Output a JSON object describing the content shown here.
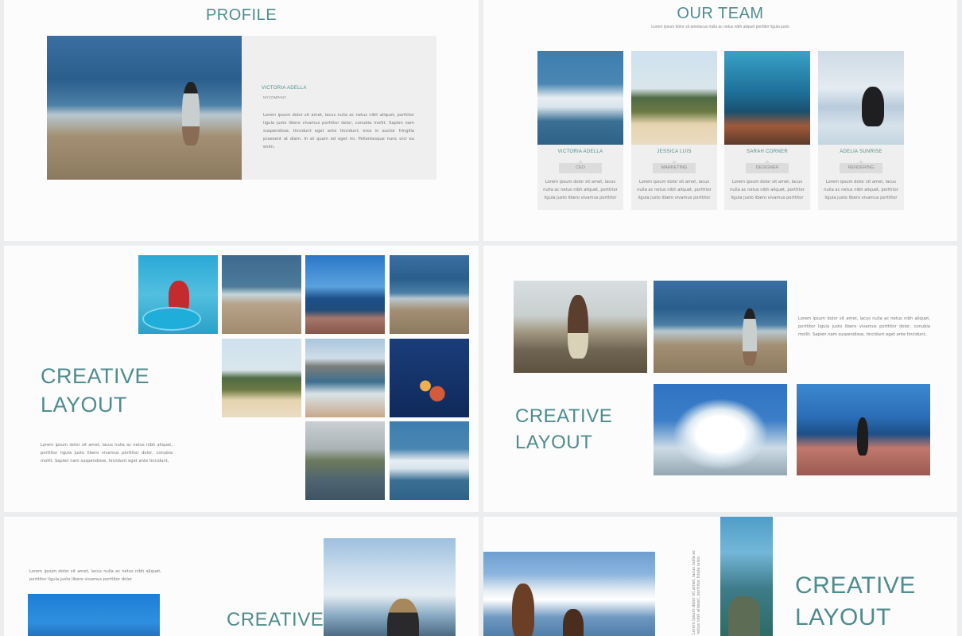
{
  "slides": {
    "profile": {
      "title": "PROFILE",
      "name": "VICTORIA ADELLA",
      "company": "MYCOMPANY",
      "text": "Lorem ipsum dolor sit amet, lacus nulla ac netus nibh aliquet, porttitor ligula justo libero vivamus porttitor dolor, conubia mollit. Sapien nam suspendisse, tincidunt eget ante tincidunt, eros in auctor fringilla praesent at diam. In et quam ed eget mi. Pellentesque nunc orci eu enim,"
    },
    "team": {
      "title": "OUR TEAM",
      "subtitle": "Lorem ipsum dolor sit ametacus nulla ac netus nibh aliquet porttitor ligula justo",
      "members": [
        {
          "name": "VICTORIA ADELLA",
          "role": "CEO",
          "text": "Lorem ipsum dolor sit amet, lacus nulla ac netus nibh aliquet, porttitor ligula justo libero vivamus porttitor"
        },
        {
          "name": "JESSICA LUIS",
          "role": "MARKETING",
          "text": "Lorem ipsum dolor sit amet, lacus nulla ac netus nibh aliquet, porttitor ligula justo libero vivamus porttitor"
        },
        {
          "name": "SARAH CORNER",
          "role": "DESIGNER",
          "text": "Lorem ipsum dolor sit amet, lacus nulla ac netus nibh aliquet, porttitor ligula justo libero vivamus porttitor"
        },
        {
          "name": "ADELIA SUNRISE",
          "role": "RENDERING",
          "text": "Lorem ipsum dolor sit amet, lacus nulla ac netus nibh aliquet, porttitor ligula justo libero vivamus porttitor"
        }
      ]
    },
    "creative1": {
      "title_line1": "CREATIVE",
      "title_line2": "LAYOUT",
      "text": "Lorem ipsum dolor sit amet, lacus nulla ac netus nibh aliquet, porttitor ligula justo libero vivamus porttitor dolor, conubia mollit. Sapien nam suspendisse, tincidunt eget ante tincidunt,"
    },
    "creative2": {
      "title_line1": "CREATIVE",
      "title_line2": "LAYOUT",
      "text": "Lorem ipsum dolor sit amet, lacus nulla ac netus nibh aliquet, porttitor ligula justo libero vivamus porttitor dolor, conubia mollit. Sapien nam suspendisse, tincidunt eget ante tincidunt,"
    },
    "creative3": {
      "title_line1": "CREATIVE",
      "text": "Lorem ipsum dolor sit amet, lacus nulla ac netus nibh aliquet, porttitor ligula justo libero vivamus porttitor dolor"
    },
    "creative4": {
      "title_line1": "CREATIVE",
      "title_line2": "LAYOUT",
      "vertical_text": "Lorem ipsum dolor sit amet, lacus nulla ac netus nibh aliquet, porttitor ligula justo"
    }
  },
  "colors": {
    "accent": "#4e8c8e",
    "panel": "#efefef",
    "background": "#fcfcfc"
  }
}
